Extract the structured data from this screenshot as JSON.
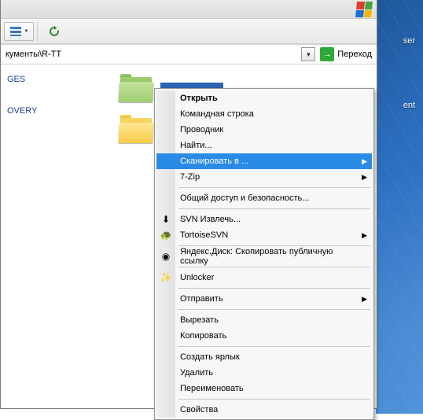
{
  "address": {
    "path": "кументы\\R-TT",
    "go_label": "Переход"
  },
  "side_items": [
    "GES",
    "OVERY"
  ],
  "folders": [
    {
      "color": "green",
      "label_fragment": ""
    },
    {
      "color": "yellow",
      "label_fragment": ""
    }
  ],
  "desktop_labels": [
    "ser",
    "ent"
  ],
  "context_menu": {
    "groups": [
      [
        {
          "label": "Открыть",
          "bold": true
        },
        {
          "label": "Командная строка"
        },
        {
          "label": "Проводник"
        },
        {
          "label": "Найти..."
        },
        {
          "label": "Сканировать в ...",
          "submenu": true,
          "highlighted": true
        },
        {
          "label": "7-Zip",
          "submenu": true
        }
      ],
      [
        {
          "label": "Общий доступ и безопасность..."
        }
      ],
      [
        {
          "label": "SVN Извлечь...",
          "icon": "svn-icon",
          "glyph": "⬇"
        },
        {
          "label": "TortoiseSVN",
          "icon": "tortoise-icon",
          "glyph": "🐢",
          "submenu": true
        }
      ],
      [
        {
          "label": "Яндекс.Диск: Скопировать публичную ссылку",
          "icon": "yadisk-icon",
          "glyph": "◉"
        }
      ],
      [
        {
          "label": "Unlocker",
          "icon": "unlocker-icon",
          "glyph": "✨"
        }
      ],
      [
        {
          "label": "Отправить",
          "submenu": true
        }
      ],
      [
        {
          "label": "Вырезать"
        },
        {
          "label": "Копировать"
        }
      ],
      [
        {
          "label": "Создать ярлык"
        },
        {
          "label": "Удалить"
        },
        {
          "label": "Переименовать"
        }
      ],
      [
        {
          "label": "Свойства"
        }
      ]
    ]
  }
}
